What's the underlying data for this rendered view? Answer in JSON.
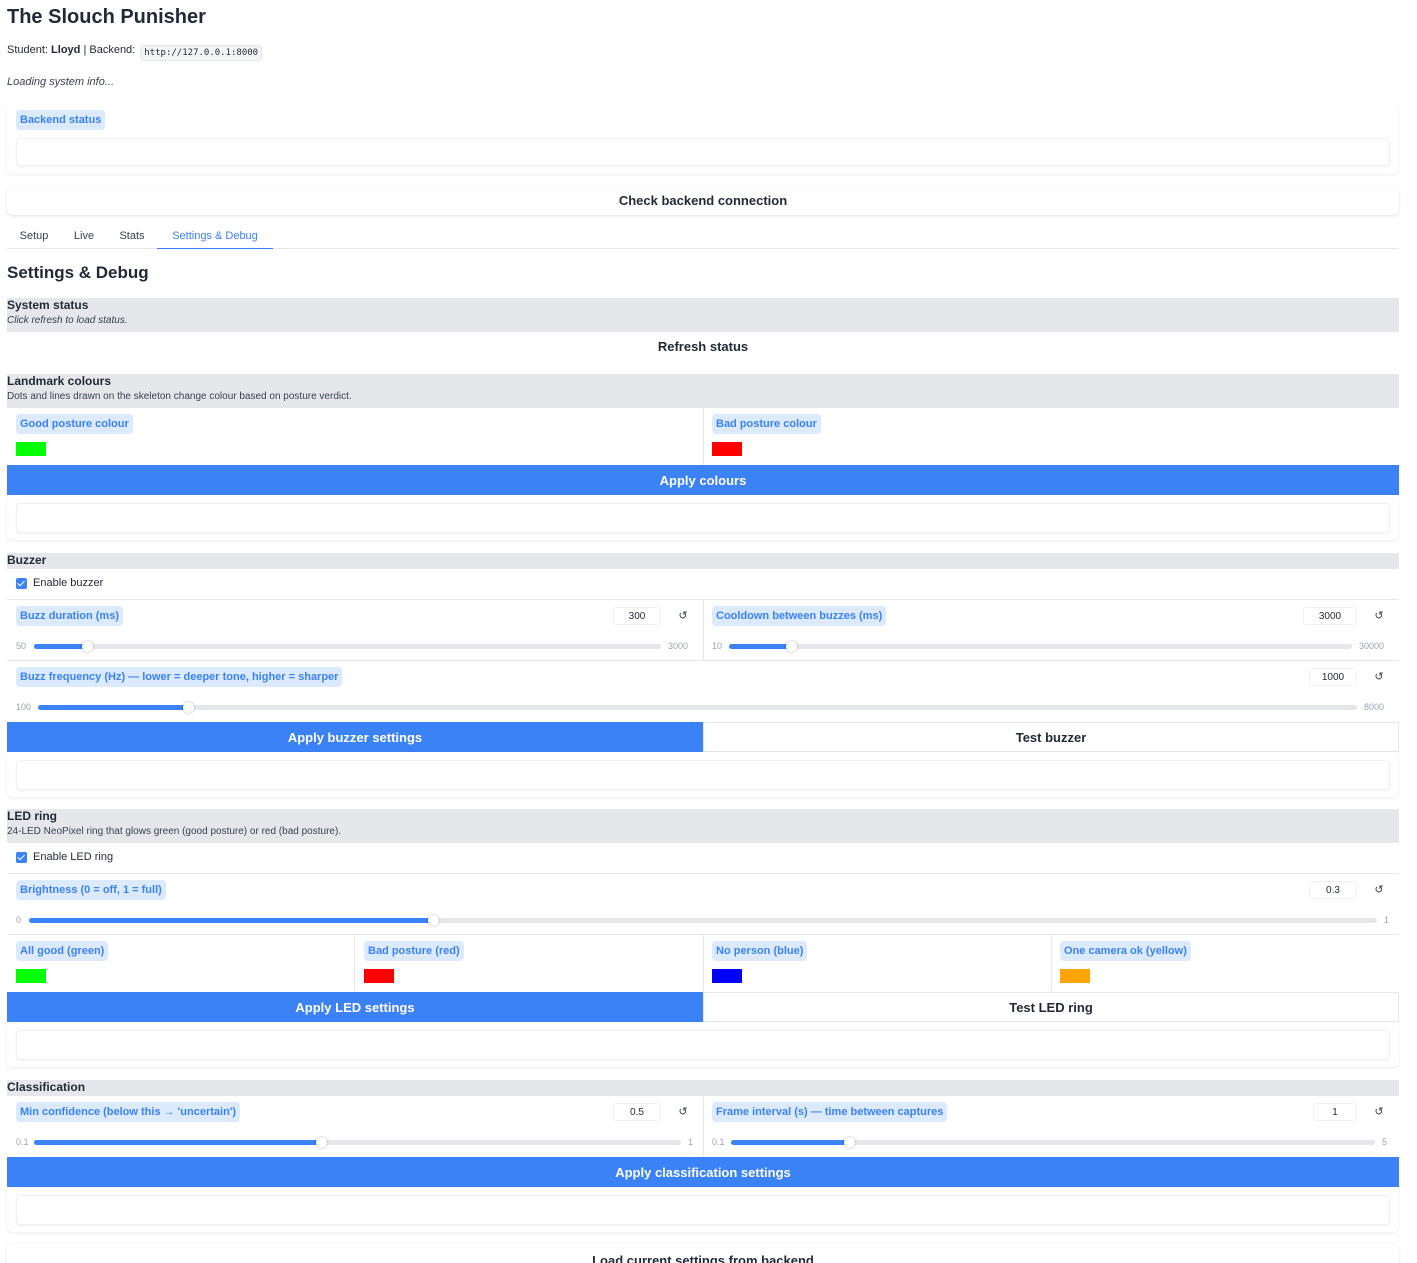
{
  "app": {
    "title": "The Slouch Punisher",
    "student_label": "Student:",
    "student_name": "Lloyd",
    "backend_label": "| Backend:",
    "backend_url": "http://127.0.0.1:8000",
    "loading_text": "Loading system info..."
  },
  "backend_status": {
    "label": "Backend status",
    "value": "",
    "check_button": "Check backend connection"
  },
  "tabs": [
    {
      "label": "Setup",
      "active": false
    },
    {
      "label": "Live",
      "active": false
    },
    {
      "label": "Stats",
      "active": false
    },
    {
      "label": "Settings & Debug",
      "active": true
    }
  ],
  "page": {
    "heading": "Settings & Debug"
  },
  "system_status": {
    "title": "System status",
    "description": "Click refresh to load status.",
    "refresh_button": "Refresh status"
  },
  "landmark_colours": {
    "title": "Landmark colours",
    "description": "Dots and lines drawn on the skeleton change colour based on posture verdict.",
    "good_label": "Good posture colour",
    "good_color": "#00ff00",
    "bad_label": "Bad posture colour",
    "bad_color": "#ff0000",
    "apply_button": "Apply colours",
    "status_output": ""
  },
  "buzzer": {
    "title": "Buzzer",
    "enable_label": "Enable buzzer",
    "enabled": true,
    "duration": {
      "label": "Buzz duration (ms)",
      "value": "300",
      "min": "50",
      "max": "3000",
      "fraction": 0.085
    },
    "cooldown": {
      "label": "Cooldown between buzzes (ms)",
      "value": "3000",
      "min": "10",
      "max": "30000",
      "fraction": 0.1
    },
    "frequency": {
      "label": "Buzz frequency (Hz) — lower = deeper tone, higher = sharper",
      "value": "1000",
      "min": "100",
      "max": "8000",
      "fraction": 0.114
    },
    "apply_button": "Apply buzzer settings",
    "test_button": "Test buzzer",
    "status_output": ""
  },
  "led_ring": {
    "title": "LED ring",
    "description": "24-LED NeoPixel ring that glows green (good posture) or red (bad posture).",
    "enable_label": "Enable LED ring",
    "enabled": true,
    "brightness": {
      "label": "Brightness (0 = off, 1 = full)",
      "value": "0.3",
      "min": "0",
      "max": "1",
      "fraction": 0.3
    },
    "colors": [
      {
        "label": "All good (green)",
        "color": "#00ff00"
      },
      {
        "label": "Bad posture (red)",
        "color": "#ff0000"
      },
      {
        "label": "No person (blue)",
        "color": "#0000ff"
      },
      {
        "label": "One camera ok (yellow)",
        "color": "#ffa500"
      }
    ],
    "apply_button": "Apply LED settings",
    "test_button": "Test LED ring",
    "status_output": ""
  },
  "classification": {
    "title": "Classification",
    "min_confidence": {
      "label": "Min confidence (below this → 'uncertain')",
      "value": "0.5",
      "min": "0.1",
      "max": "1",
      "fraction": 0.444
    },
    "frame_interval": {
      "label": "Frame interval (s) — time between captures",
      "value": "1",
      "min": "0.1",
      "max": "5",
      "fraction": 0.184
    },
    "apply_button": "Apply classification settings",
    "status_output": ""
  },
  "load_button": "Load current settings from backend",
  "colors": {
    "accent": "#3b82f6",
    "pill_bg": "#dbeafe",
    "section_bg": "#e5e7eb"
  }
}
